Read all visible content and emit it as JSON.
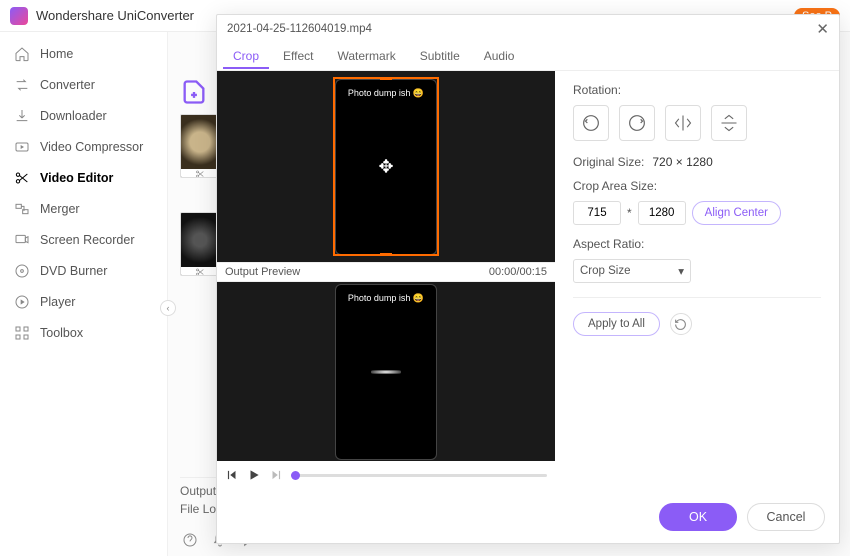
{
  "app": {
    "title": "Wondershare UniConverter",
    "badge": "See P"
  },
  "sidebar": {
    "items": [
      {
        "label": "Home"
      },
      {
        "label": "Converter"
      },
      {
        "label": "Downloader"
      },
      {
        "label": "Video Compressor"
      },
      {
        "label": "Video Editor"
      },
      {
        "label": "Merger"
      },
      {
        "label": "Screen Recorder"
      },
      {
        "label": "DVD Burner"
      },
      {
        "label": "Player"
      },
      {
        "label": "Toolbox"
      }
    ],
    "activeIndex": 4
  },
  "content": {
    "footer1": "Output F",
    "footer2": "File Loca"
  },
  "modal": {
    "filename": "2021-04-25-112604019.mp4",
    "tabs": [
      {
        "label": "Crop"
      },
      {
        "label": "Effect"
      },
      {
        "label": "Watermark"
      },
      {
        "label": "Subtitle"
      },
      {
        "label": "Audio"
      }
    ],
    "activeTab": 0,
    "phoneLabel": "Photo dump ish 😄",
    "outputPreviewLabel": "Output Preview",
    "time": "00:00/00:15",
    "settings": {
      "rotationLabel": "Rotation:",
      "originalSizeLabel": "Original Size:",
      "originalSize": "720 × 1280",
      "cropAreaLabel": "Crop Area Size:",
      "cropW": "715",
      "cropH": "1280",
      "alignCenter": "Align Center",
      "aspectLabel": "Aspect Ratio:",
      "aspectValue": "Crop Size",
      "applyAll": "Apply to All"
    },
    "ok": "OK",
    "cancel": "Cancel"
  }
}
